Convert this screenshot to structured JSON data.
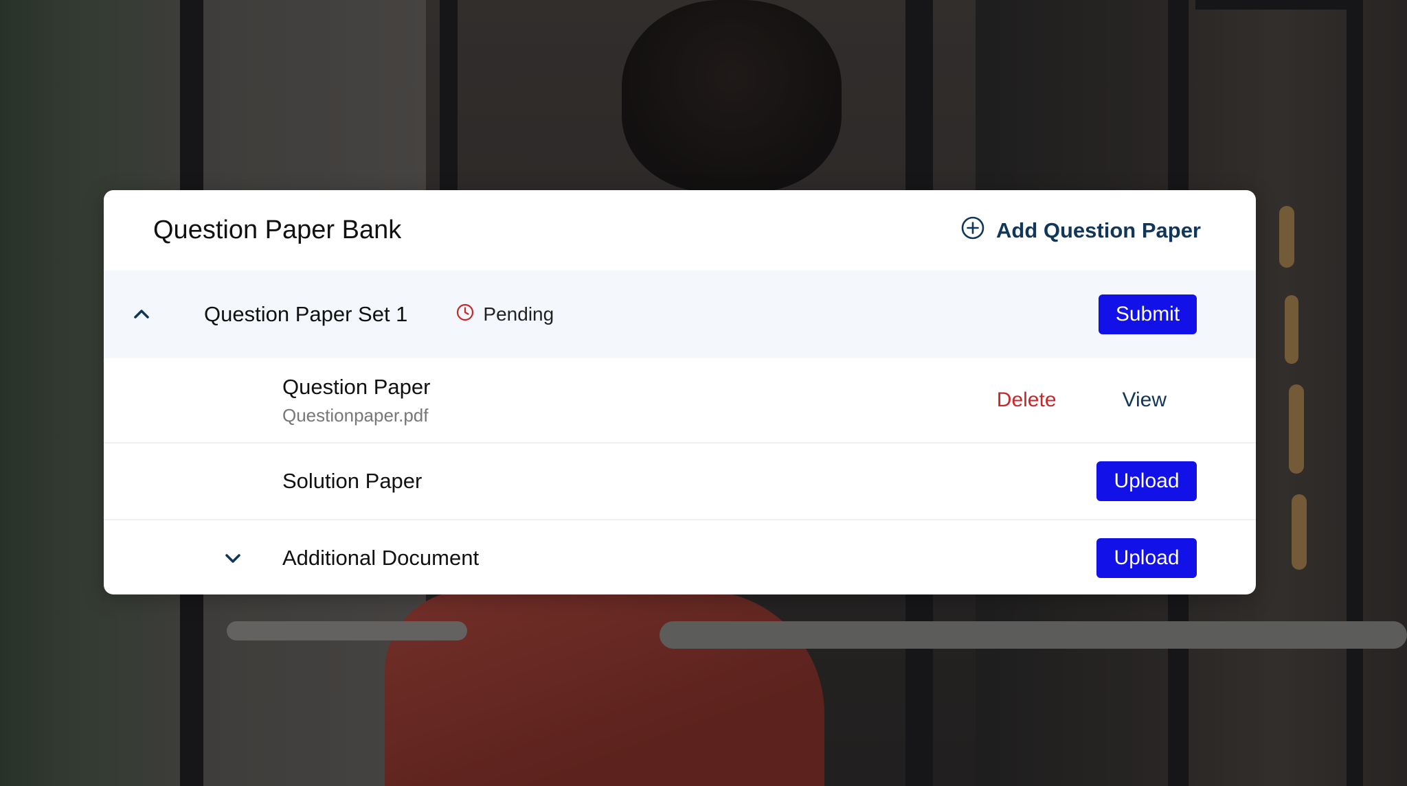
{
  "header": {
    "title": "Question Paper Bank",
    "add_label": "Add Question Paper"
  },
  "set": {
    "name": "Question Paper Set 1",
    "status": "Pending",
    "submit_label": "Submit"
  },
  "documents": [
    {
      "title": "Question Paper",
      "file": "Questionpaper.pdf",
      "delete_label": "Delete",
      "view_label": "View"
    },
    {
      "title": "Solution Paper",
      "upload_label": "Upload"
    },
    {
      "title": "Additional Document",
      "upload_label": "Upload"
    }
  ],
  "colors": {
    "primary_button": "#1111e8",
    "link_navy": "#10365a",
    "delete_red": "#c8272a",
    "pending_clock": "#c8272a"
  },
  "icons": {
    "add": "plus-circle-icon",
    "collapse": "chevron-up-icon",
    "status": "clock-icon",
    "expand": "chevron-down-icon"
  }
}
